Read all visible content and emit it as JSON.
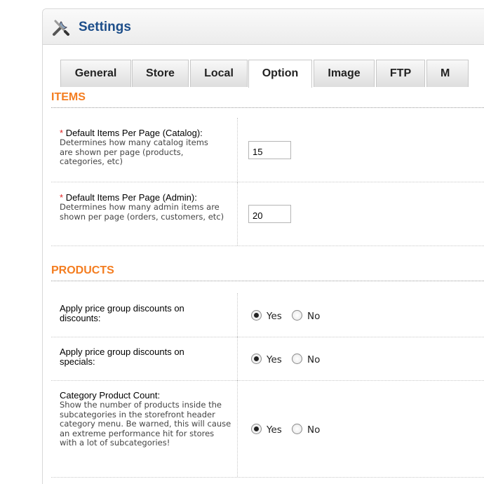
{
  "header": {
    "title": "Settings",
    "icon": "tools-icon"
  },
  "tabs": [
    {
      "label": "General",
      "active": false
    },
    {
      "label": "Store",
      "active": false
    },
    {
      "label": "Local",
      "active": false
    },
    {
      "label": "Option",
      "active": true
    },
    {
      "label": "Image",
      "active": false
    },
    {
      "label": "FTP",
      "active": false
    },
    {
      "label": "M",
      "active": false
    }
  ],
  "sections": {
    "items": {
      "title": "ITEMS",
      "catalog": {
        "required_mark": "*",
        "label": "Default Items Per Page (Catalog):",
        "help": "Determines how many catalog items are shown per page (products, categories, etc)",
        "value": "15"
      },
      "admin": {
        "required_mark": "*",
        "label": "Default Items Per Page (Admin):",
        "help": "Determines how many admin items are shown per page (orders, customers, etc)",
        "value": "20"
      }
    },
    "products": {
      "title": "PRODUCTS",
      "discounts": {
        "label": "Apply price group discounts on discounts:",
        "yes": "Yes",
        "no": "No",
        "selected": "Yes"
      },
      "specials": {
        "label": "Apply price group discounts on specials:",
        "yes": "Yes",
        "no": "No",
        "selected": "Yes"
      },
      "category_count": {
        "label": "Category Product Count:",
        "help": "Show the number of products inside the subcategories in the storefront header category menu. Be warned, this will cause an extreme performance hit for stores with a lot of subcategories!",
        "yes": "Yes",
        "no": "No",
        "selected": "Yes"
      }
    }
  },
  "colors": {
    "accent": "#f47d20",
    "title": "#1d4e8a"
  }
}
